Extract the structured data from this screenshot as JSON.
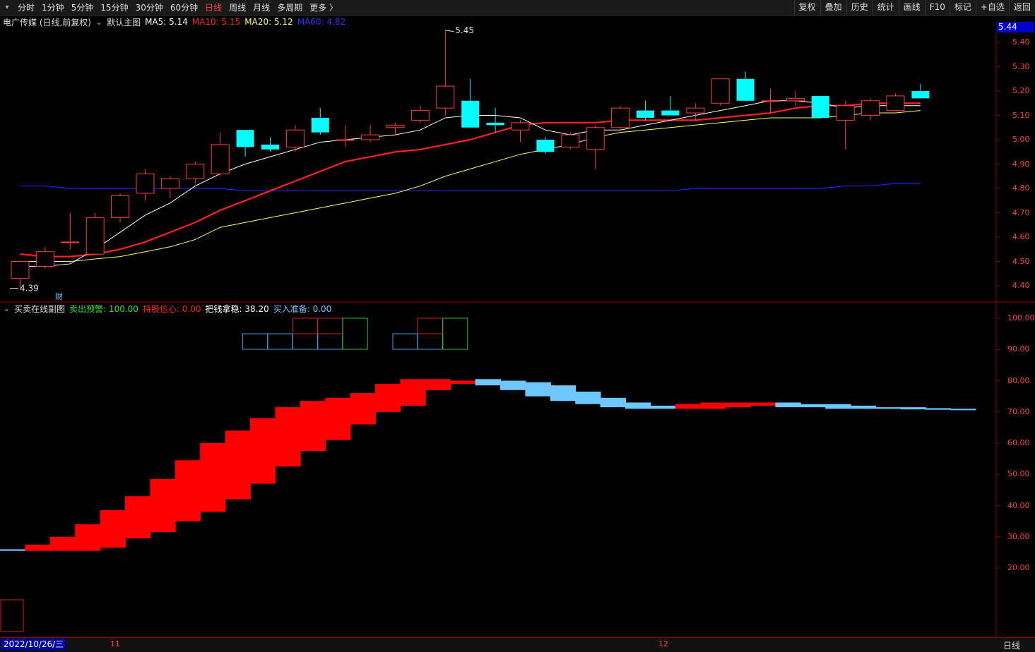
{
  "toolbar": {
    "periods": [
      "分时",
      "1分钟",
      "5分钟",
      "15分钟",
      "30分钟",
      "60分钟",
      "日线",
      "周线",
      "月线",
      "多周期",
      "更多 〉"
    ],
    "active_period": "日线",
    "buttons": [
      "复权",
      "叠加",
      "历史",
      "统计",
      "画线",
      "F10",
      "标记",
      "+自选",
      "返回"
    ]
  },
  "main_panel": {
    "stock_title": "电广传媒 (日线,前复权)",
    "template": "默认主图",
    "ma5": "MA5: 5.14",
    "ma10": "MA10: 5.15",
    "ma20": "MA20: 5.12",
    "ma60": "MA60: 4.82",
    "current_price_tag": "5.44",
    "high_annotation": "5.45",
    "low_annotation": "4.39",
    "cai_marker": "财",
    "y_ticks": [
      "5.40",
      "5.30",
      "5.20",
      "5.10",
      "5.00",
      "4.90",
      "4.80",
      "4.70",
      "4.60",
      "4.50",
      "4.40"
    ]
  },
  "sub_panel": {
    "title": "买卖在线副图",
    "sell_warning": "卖出预警: 100.00",
    "hold_confidence": "持股信心: 0.00",
    "grasp_money": "把钱拿稳: 38.20",
    "buy_ready": "买入准备: 0.00",
    "y_ticks": [
      "100.00",
      "90.00",
      "80.00",
      "70.00",
      "60.00",
      "50.00",
      "40.00",
      "30.00",
      "20.00"
    ]
  },
  "bottom_bar": {
    "date": "2022/10/26/三",
    "month_ticks": [
      "11",
      "12"
    ],
    "period": "日线"
  },
  "colors": {
    "up": "#ff3b3b",
    "down": "#00ffff",
    "ma5": "#ffffff",
    "ma10": "#ff2020",
    "ma20": "#ffff60",
    "ma60": "#2020ff",
    "sub_red": "#ff0000",
    "sub_blue": "#6cc8ff"
  },
  "chart_data": {
    "type": "candlestick",
    "candles": [
      {
        "o": 4.43,
        "h": 4.5,
        "l": 4.39,
        "c": 4.5
      },
      {
        "o": 4.48,
        "h": 4.56,
        "l": 4.47,
        "c": 4.54
      },
      {
        "o": 4.58,
        "h": 4.7,
        "l": 4.55,
        "c": 4.58
      },
      {
        "o": 4.53,
        "h": 4.7,
        "l": 4.53,
        "c": 4.68
      },
      {
        "o": 4.68,
        "h": 4.78,
        "l": 4.66,
        "c": 4.77
      },
      {
        "o": 4.78,
        "h": 4.88,
        "l": 4.75,
        "c": 4.86
      },
      {
        "o": 4.8,
        "h": 4.85,
        "l": 4.76,
        "c": 4.84
      },
      {
        "o": 4.84,
        "h": 4.91,
        "l": 4.82,
        "c": 4.9
      },
      {
        "o": 4.86,
        "h": 5.03,
        "l": 4.85,
        "c": 4.98
      },
      {
        "o": 5.04,
        "h": 5.04,
        "l": 4.93,
        "c": 4.97
      },
      {
        "o": 4.98,
        "h": 5.01,
        "l": 4.95,
        "c": 4.96
      },
      {
        "o": 4.97,
        "h": 5.06,
        "l": 4.95,
        "c": 5.04
      },
      {
        "o": 5.09,
        "h": 5.13,
        "l": 5.02,
        "c": 5.03
      },
      {
        "o": 5.0,
        "h": 5.06,
        "l": 4.97,
        "c": 5.0
      },
      {
        "o": 5.0,
        "h": 5.06,
        "l": 4.99,
        "c": 5.02
      },
      {
        "o": 5.05,
        "h": 5.07,
        "l": 5.02,
        "c": 5.06
      },
      {
        "o": 5.08,
        "h": 5.14,
        "l": 5.07,
        "c": 5.12
      },
      {
        "o": 5.13,
        "h": 5.45,
        "l": 5.1,
        "c": 5.22
      },
      {
        "o": 5.16,
        "h": 5.25,
        "l": 5.05,
        "c": 5.05
      },
      {
        "o": 5.07,
        "h": 5.13,
        "l": 5.03,
        "c": 5.06
      },
      {
        "o": 5.04,
        "h": 5.08,
        "l": 4.99,
        "c": 5.07
      },
      {
        "o": 5.0,
        "h": 5.01,
        "l": 4.94,
        "c": 4.95
      },
      {
        "o": 4.97,
        "h": 5.03,
        "l": 4.96,
        "c": 5.02
      },
      {
        "o": 4.96,
        "h": 5.06,
        "l": 4.88,
        "c": 5.05
      },
      {
        "o": 5.05,
        "h": 5.14,
        "l": 5.04,
        "c": 5.13
      },
      {
        "o": 5.12,
        "h": 5.16,
        "l": 5.08,
        "c": 5.09
      },
      {
        "o": 5.12,
        "h": 5.18,
        "l": 5.1,
        "c": 5.1
      },
      {
        "o": 5.11,
        "h": 5.15,
        "l": 5.08,
        "c": 5.13
      },
      {
        "o": 5.15,
        "h": 5.25,
        "l": 5.14,
        "c": 5.25
      },
      {
        "o": 5.25,
        "h": 5.28,
        "l": 5.16,
        "c": 5.16
      },
      {
        "o": 5.16,
        "h": 5.21,
        "l": 5.11,
        "c": 5.16
      },
      {
        "o": 5.16,
        "h": 5.2,
        "l": 5.14,
        "c": 5.17
      },
      {
        "o": 5.18,
        "h": 5.18,
        "l": 5.09,
        "c": 5.09
      },
      {
        "o": 5.08,
        "h": 5.16,
        "l": 4.96,
        "c": 5.14
      },
      {
        "o": 5.1,
        "h": 5.17,
        "l": 5.08,
        "c": 5.16
      },
      {
        "o": 5.12,
        "h": 5.19,
        "l": 5.12,
        "c": 5.18
      },
      {
        "o": 5.2,
        "h": 5.23,
        "l": 5.17,
        "c": 5.17
      }
    ],
    "ma5": [
      4.48,
      4.48,
      4.49,
      4.55,
      4.62,
      4.69,
      4.74,
      4.81,
      4.86,
      4.9,
      4.93,
      4.96,
      4.99,
      5.0,
      5.01,
      5.02,
      5.04,
      5.09,
      5.1,
      5.1,
      5.09,
      5.04,
      5.02,
      5.04,
      5.04,
      5.06,
      5.08,
      5.1,
      5.12,
      5.14,
      5.16,
      5.16,
      5.15,
      5.13,
      5.14,
      5.14,
      5.14
    ],
    "ma10": [
      4.53,
      4.52,
      4.52,
      4.53,
      4.55,
      4.58,
      4.62,
      4.66,
      4.71,
      4.75,
      4.79,
      4.83,
      4.87,
      4.91,
      4.93,
      4.95,
      4.96,
      4.98,
      5.0,
      5.03,
      5.06,
      5.07,
      5.07,
      5.07,
      5.08,
      5.08,
      5.08,
      5.08,
      5.09,
      5.1,
      5.11,
      5.13,
      5.14,
      5.14,
      5.15,
      5.15,
      5.15
    ],
    "ma20": [
      4.5,
      4.5,
      4.5,
      4.51,
      4.52,
      4.54,
      4.56,
      4.59,
      4.64,
      4.66,
      4.68,
      4.7,
      4.72,
      4.74,
      4.76,
      4.78,
      4.81,
      4.85,
      4.88,
      4.91,
      4.94,
      4.96,
      4.98,
      5.01,
      5.03,
      5.04,
      5.05,
      5.06,
      5.07,
      5.08,
      5.09,
      5.09,
      5.09,
      5.1,
      5.11,
      5.11,
      5.12
    ],
    "ma60": [
      4.81,
      4.81,
      4.8,
      4.8,
      4.8,
      4.8,
      4.8,
      4.8,
      4.8,
      4.79,
      4.79,
      4.79,
      4.79,
      4.79,
      4.79,
      4.79,
      4.79,
      4.79,
      4.79,
      4.79,
      4.79,
      4.79,
      4.79,
      4.79,
      4.79,
      4.79,
      4.79,
      4.8,
      4.8,
      4.8,
      4.8,
      4.8,
      4.8,
      4.81,
      4.81,
      4.82,
      4.82
    ],
    "sub_bars": [
      {
        "lo": 25.5,
        "hi": 26.0,
        "color": "blue"
      },
      {
        "lo": 25.5,
        "hi": 27.5,
        "color": "red"
      },
      {
        "lo": 25.5,
        "hi": 30.0,
        "color": "red"
      },
      {
        "lo": 25.5,
        "hi": 34.0,
        "color": "red"
      },
      {
        "lo": 26.5,
        "hi": 38.5,
        "color": "red"
      },
      {
        "lo": 29.5,
        "hi": 43.0,
        "color": "red"
      },
      {
        "lo": 31.5,
        "hi": 48.5,
        "color": "red"
      },
      {
        "lo": 35.0,
        "hi": 54.5,
        "color": "red"
      },
      {
        "lo": 38.0,
        "hi": 60.0,
        "color": "red"
      },
      {
        "lo": 42.0,
        "hi": 64.0,
        "color": "red"
      },
      {
        "lo": 47.0,
        "hi": 68.0,
        "color": "red"
      },
      {
        "lo": 52.5,
        "hi": 71.5,
        "color": "red"
      },
      {
        "lo": 57.5,
        "hi": 73.5,
        "color": "red"
      },
      {
        "lo": 61.0,
        "hi": 74.5,
        "color": "red"
      },
      {
        "lo": 66.0,
        "hi": 76.0,
        "color": "red"
      },
      {
        "lo": 70.0,
        "hi": 79.0,
        "color": "red"
      },
      {
        "lo": 72.0,
        "hi": 80.5,
        "color": "red"
      },
      {
        "lo": 77.0,
        "hi": 80.5,
        "color": "red"
      },
      {
        "lo": 79.0,
        "hi": 80.0,
        "color": "red"
      },
      {
        "lo": 78.5,
        "hi": 80.5,
        "color": "blue"
      },
      {
        "lo": 77.0,
        "hi": 80.0,
        "color": "blue"
      },
      {
        "lo": 75.0,
        "hi": 79.5,
        "color": "blue"
      },
      {
        "lo": 73.5,
        "hi": 78.5,
        "color": "blue"
      },
      {
        "lo": 72.5,
        "hi": 76.5,
        "color": "blue"
      },
      {
        "lo": 71.5,
        "hi": 74.5,
        "color": "blue"
      },
      {
        "lo": 71.0,
        "hi": 73.0,
        "color": "blue"
      },
      {
        "lo": 71.0,
        "hi": 72.0,
        "color": "blue"
      },
      {
        "lo": 71.0,
        "hi": 72.5,
        "color": "red"
      },
      {
        "lo": 71.0,
        "hi": 73.0,
        "color": "red"
      },
      {
        "lo": 71.5,
        "hi": 73.0,
        "color": "red"
      },
      {
        "lo": 72.0,
        "hi": 73.0,
        "color": "red"
      },
      {
        "lo": 71.5,
        "hi": 73.0,
        "color": "blue"
      },
      {
        "lo": 71.5,
        "hi": 72.5,
        "color": "blue"
      },
      {
        "lo": 71.0,
        "hi": 72.5,
        "color": "blue"
      },
      {
        "lo": 71.0,
        "hi": 72.0,
        "color": "blue"
      },
      {
        "lo": 71.0,
        "hi": 71.5,
        "color": "blue"
      },
      {
        "lo": 70.8,
        "hi": 71.5,
        "color": "blue"
      },
      {
        "lo": 70.7,
        "hi": 71.2,
        "color": "blue"
      },
      {
        "lo": 70.7,
        "hi": 71.0,
        "color": "blue"
      }
    ],
    "signal_boxes": [
      {
        "index": 9,
        "level": 1,
        "color": "blue"
      },
      {
        "index": 10,
        "level": 1,
        "color": "blue"
      },
      {
        "index": 11,
        "level": 1,
        "color": "blue"
      },
      {
        "index": 11,
        "level": 2,
        "color": "red"
      },
      {
        "index": 12,
        "level": 1,
        "color": "blue"
      },
      {
        "index": 12,
        "level": 2,
        "color": "red"
      },
      {
        "index": 13,
        "level": 12,
        "color": "green"
      },
      {
        "index": 15,
        "level": 1,
        "color": "blue"
      },
      {
        "index": 16,
        "level": 1,
        "color": "blue"
      },
      {
        "index": 16,
        "level": 2,
        "color": "red"
      },
      {
        "index": 17,
        "level": 12,
        "color": "green"
      }
    ]
  }
}
